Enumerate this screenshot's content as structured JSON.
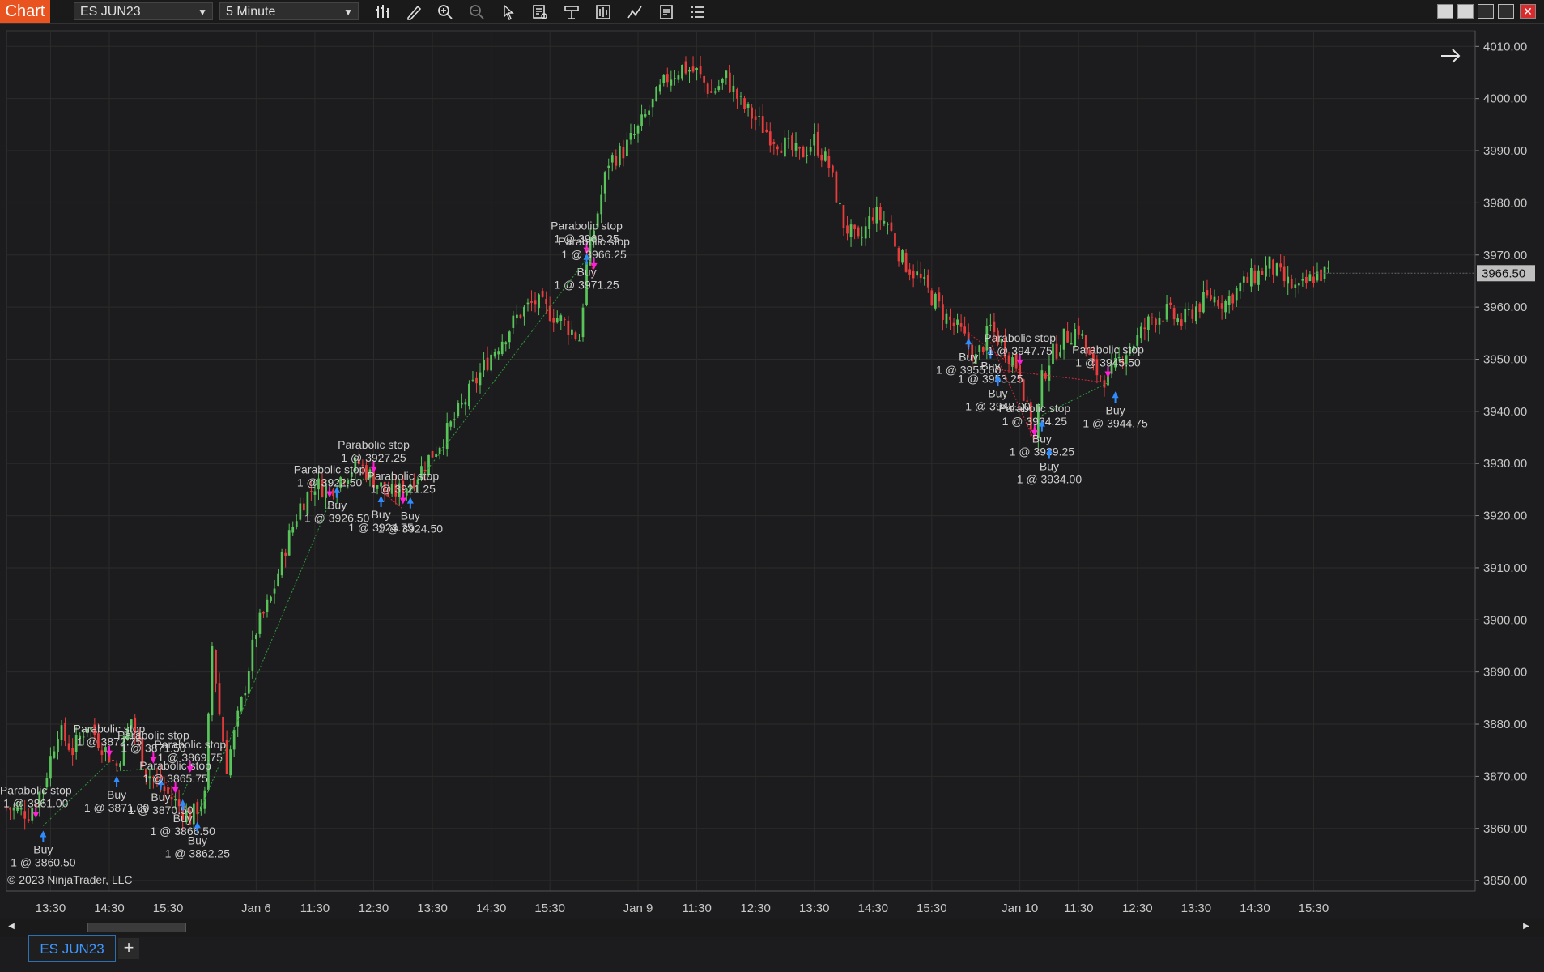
{
  "toolbar": {
    "chart_label": "Chart",
    "instrument": "ES JUN23",
    "interval": "5 Minute",
    "icons": [
      "bar-type-icon",
      "pencil-draw-icon",
      "zoom-in-icon",
      "zoom-out-icon",
      "pointer-icon",
      "data-box-icon",
      "properties-icon",
      "indicators-icon",
      "strategies-icon",
      "templates-icon",
      "list-icon"
    ]
  },
  "footer": {
    "copyright": "© 2023 NinjaTrader, LLC",
    "tab_label": "ES JUN23",
    "add_tab": "+"
  },
  "colors": {
    "background": "#1c1c1e",
    "up_candle": "#58c45a",
    "down_candle": "#ea3c3c",
    "accent": "#e8531f",
    "buy_arrow": "#2f8cff",
    "stop_arrow": "#ff1fd4",
    "price_marker": "#bfbfbf",
    "grid": "#2b2b2b"
  },
  "chart_data": {
    "type": "candlestick",
    "price_label": "3966.50",
    "ylim": [
      3848,
      4013
    ],
    "yticks": [
      3850,
      3860,
      3870,
      3880,
      3890,
      3900,
      3910,
      3920,
      3930,
      3940,
      3950,
      3960,
      3970,
      3980,
      3990,
      4000,
      4010
    ],
    "xlim": [
      0,
      200
    ],
    "xticks": [
      {
        "x": 6,
        "label": "13:30"
      },
      {
        "x": 14,
        "label": "14:30"
      },
      {
        "x": 22,
        "label": "15:30"
      },
      {
        "x": 34,
        "label": "Jan 6"
      },
      {
        "x": 42,
        "label": "11:30"
      },
      {
        "x": 50,
        "label": "12:30"
      },
      {
        "x": 58,
        "label": "13:30"
      },
      {
        "x": 66,
        "label": "14:30"
      },
      {
        "x": 74,
        "label": "15:30"
      },
      {
        "x": 86,
        "label": "Jan 9"
      },
      {
        "x": 94,
        "label": "11:30"
      },
      {
        "x": 102,
        "label": "12:30"
      },
      {
        "x": 110,
        "label": "13:30"
      },
      {
        "x": 118,
        "label": "14:30"
      },
      {
        "x": 126,
        "label": "15:30"
      },
      {
        "x": 138,
        "label": "Jan 10"
      },
      {
        "x": 146,
        "label": "11:30"
      },
      {
        "x": 154,
        "label": "12:30"
      },
      {
        "x": 162,
        "label": "13:30"
      },
      {
        "x": 170,
        "label": "14:30"
      },
      {
        "x": 178,
        "label": "15:30"
      }
    ],
    "close_path": [
      [
        0,
        3864
      ],
      [
        3,
        3863
      ],
      [
        5,
        3868
      ],
      [
        7,
        3879
      ],
      [
        9,
        3875
      ],
      [
        11,
        3880
      ],
      [
        13,
        3876
      ],
      [
        15,
        3872
      ],
      [
        17,
        3881
      ],
      [
        19,
        3871
      ],
      [
        21,
        3868
      ],
      [
        23,
        3865
      ],
      [
        25,
        3862
      ],
      [
        27,
        3866
      ],
      [
        28,
        3895
      ],
      [
        29,
        3882
      ],
      [
        30,
        3872
      ],
      [
        32,
        3884
      ],
      [
        34,
        3898
      ],
      [
        36,
        3904
      ],
      [
        38,
        3914
      ],
      [
        40,
        3922
      ],
      [
        42,
        3926
      ],
      [
        44,
        3925
      ],
      [
        46,
        3928
      ],
      [
        48,
        3930
      ],
      [
        50,
        3927
      ],
      [
        52,
        3924
      ],
      [
        54,
        3925
      ],
      [
        56,
        3928
      ],
      [
        58,
        3932
      ],
      [
        60,
        3936
      ],
      [
        62,
        3941
      ],
      [
        64,
        3946
      ],
      [
        66,
        3951
      ],
      [
        68,
        3955
      ],
      [
        70,
        3959
      ],
      [
        72,
        3961
      ],
      [
        74,
        3959
      ],
      [
        76,
        3957
      ],
      [
        78,
        3954
      ],
      [
        79,
        3968
      ],
      [
        80,
        3975
      ],
      [
        82,
        3988
      ],
      [
        84,
        3990
      ],
      [
        86,
        3994
      ],
      [
        88,
        3999
      ],
      [
        90,
        4004
      ],
      [
        92,
        4006
      ],
      [
        94,
        4005
      ],
      [
        96,
        4001
      ],
      [
        98,
        4004
      ],
      [
        100,
        3999
      ],
      [
        102,
        3996
      ],
      [
        104,
        3993
      ],
      [
        106,
        3991
      ],
      [
        108,
        3989
      ],
      [
        110,
        3992
      ],
      [
        112,
        3987
      ],
      [
        114,
        3976
      ],
      [
        116,
        3972
      ],
      [
        118,
        3978
      ],
      [
        120,
        3976
      ],
      [
        122,
        3969
      ],
      [
        124,
        3966
      ],
      [
        126,
        3962
      ],
      [
        128,
        3958
      ],
      [
        130,
        3955
      ],
      [
        132,
        3950
      ],
      [
        134,
        3956
      ],
      [
        136,
        3952
      ],
      [
        138,
        3948
      ],
      [
        139,
        3940
      ],
      [
        140,
        3935
      ],
      [
        141,
        3946
      ],
      [
        142,
        3950
      ],
      [
        144,
        3954
      ],
      [
        146,
        3956
      ],
      [
        148,
        3948
      ],
      [
        150,
        3946
      ],
      [
        152,
        3951
      ],
      [
        154,
        3954
      ],
      [
        156,
        3958
      ],
      [
        158,
        3959
      ],
      [
        160,
        3957
      ],
      [
        162,
        3960
      ],
      [
        164,
        3962
      ],
      [
        166,
        3961
      ],
      [
        168,
        3964
      ],
      [
        170,
        3966
      ],
      [
        172,
        3968
      ],
      [
        174,
        3965
      ],
      [
        176,
        3963
      ],
      [
        178,
        3966
      ],
      [
        180,
        3966.5
      ]
    ],
    "trades": [
      {
        "x": 4,
        "price": 3861.0,
        "action": "stop"
      },
      {
        "x": 5,
        "price": 3860.5,
        "action": "buy"
      },
      {
        "x": 14,
        "price": 3872.75,
        "action": "stop"
      },
      {
        "x": 15,
        "price": 3871.0,
        "action": "buy"
      },
      {
        "x": 20,
        "price": 3871.5,
        "action": "stop"
      },
      {
        "x": 21,
        "price": 3870.5,
        "action": "buy"
      },
      {
        "x": 23,
        "price": 3865.75,
        "action": "stop"
      },
      {
        "x": 24,
        "price": 3866.5,
        "action": "buy"
      },
      {
        "x": 25,
        "price": 3869.75,
        "action": "stop"
      },
      {
        "x": 26,
        "price": 3862.25,
        "action": "buy"
      },
      {
        "x": 44,
        "price": 3922.5,
        "action": "stop"
      },
      {
        "x": 45,
        "price": 3926.5,
        "action": "buy"
      },
      {
        "x": 50,
        "price": 3927.25,
        "action": "stop"
      },
      {
        "x": 51,
        "price": 3924.75,
        "action": "buy"
      },
      {
        "x": 54,
        "price": 3921.25,
        "action": "stop"
      },
      {
        "x": 55,
        "price": 3924.5,
        "action": "buy"
      },
      {
        "x": 79,
        "price": 3969.25,
        "action": "stop"
      },
      {
        "x": 80,
        "price": 3966.25,
        "action": "stop"
      },
      {
        "x": 79,
        "price": 3971.25,
        "action": "buy"
      },
      {
        "x": 131,
        "price": 3955.0,
        "action": "buy"
      },
      {
        "x": 134,
        "price": 3953.25,
        "action": "buy"
      },
      {
        "x": 135,
        "price": 3948.0,
        "action": "buy"
      },
      {
        "x": 138,
        "price": 3947.75,
        "action": "stop"
      },
      {
        "x": 140,
        "price": 3934.25,
        "action": "stop"
      },
      {
        "x": 141,
        "price": 3939.25,
        "action": "buy"
      },
      {
        "x": 142,
        "price": 3934.0,
        "action": "buy"
      },
      {
        "x": 150,
        "price": 3945.5,
        "action": "stop"
      },
      {
        "x": 151,
        "price": 3944.75,
        "action": "buy"
      }
    ]
  }
}
